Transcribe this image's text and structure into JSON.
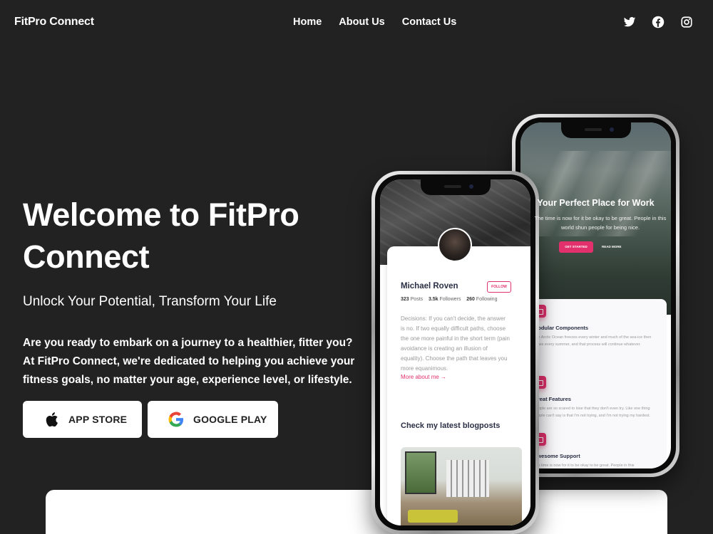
{
  "brand": "FitPro Connect",
  "nav": {
    "home": "Home",
    "about": "About Us",
    "contact": "Contact Us"
  },
  "social": [
    "twitter-icon",
    "facebook-icon",
    "instagram-icon"
  ],
  "hero": {
    "title": "Welcome to FitPro Connect",
    "subtitle": "Unlock Your Potential, Transform Your Life",
    "body": "Are you ready to embark on a journey to a healthier, fitter you? At FitPro Connect, we're dedicated to helping you achieve your fitness goals, no matter your age, experience level, or lifestyle.",
    "app_store": "APP STORE",
    "google_play": "GOOGLE PLAY"
  },
  "phone_profile": {
    "name": "Michael Roven",
    "follow": "FOLLOW",
    "posts": "323",
    "posts_label": "Posts",
    "followers": "3.5k",
    "followers_label": "Followers",
    "following": "260",
    "following_label": "Following",
    "description": "Decisions: If you can't decide, the answer is no. If two equally difficult paths, choose the one more painful in the short term (pain avoidance is creating an illusion of equality). Choose the path that leaves you more equanimous.",
    "more": "More about me →",
    "blog_heading": "Check my latest blogposts"
  },
  "phone_landing": {
    "title": "Your Perfect Place for Work",
    "text": "The time is now for it be okay to be great. People in this world shun people for being nice.",
    "get_started": "GET STARTED",
    "read_more": "READ MORE",
    "features": [
      {
        "icon": "calendar-icon",
        "title": "Modular Components",
        "text": "The Arctic Ocean freezes every winter and much of the sea-ice then thaws every summer, and that process will continue whatever."
      },
      {
        "icon": "chart-icon",
        "title": "Great Features",
        "text": "People are so scared to lose that they don't even try. Like one thing people can't say is that I'm not trying, and I'm not trying my hardest."
      },
      {
        "icon": "support-icon",
        "title": "Awesome Support",
        "text": "The time is now for it to be okay to be great. People in this"
      }
    ]
  },
  "colors": {
    "background": "#222222",
    "accent": "#e2306c",
    "text": "#ffffff"
  }
}
